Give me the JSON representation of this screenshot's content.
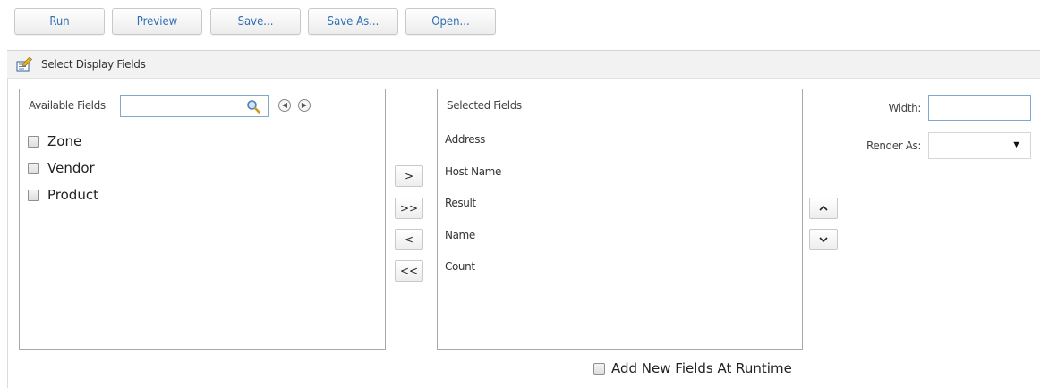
{
  "toolbar": {
    "buttons": [
      {
        "label": "Run"
      },
      {
        "label": "Preview"
      },
      {
        "label": "Save..."
      },
      {
        "label": "Save As..."
      },
      {
        "label": "Open..."
      }
    ]
  },
  "section": {
    "title": "Select Display Fields",
    "icon": "edit-fields-icon"
  },
  "available": {
    "label": "Available Fields",
    "search_value": "",
    "search_icon": "search-icon",
    "prev_icon": "circle-left-icon",
    "next_icon": "circle-right-icon",
    "items": [
      {
        "label": "Zone",
        "checked": false
      },
      {
        "label": "Vendor",
        "checked": false
      },
      {
        "label": "Product",
        "checked": false
      }
    ]
  },
  "move": {
    "add_one": ">",
    "add_all": ">>",
    "remove_one": "<",
    "remove_all": "<<"
  },
  "selected": {
    "label": "Selected Fields",
    "items": [
      {
        "label": "Address"
      },
      {
        "label": "Host Name"
      },
      {
        "label": "Result"
      },
      {
        "label": "Name"
      },
      {
        "label": "Count"
      }
    ]
  },
  "order": {
    "up_icon": "chevron-up-icon",
    "down_icon": "chevron-down-icon"
  },
  "properties": {
    "width_label": "Width:",
    "width_value": "",
    "render_label": "Render As:",
    "render_value": ""
  },
  "runtime": {
    "label": "Add New Fields At Runtime",
    "checked": false
  }
}
